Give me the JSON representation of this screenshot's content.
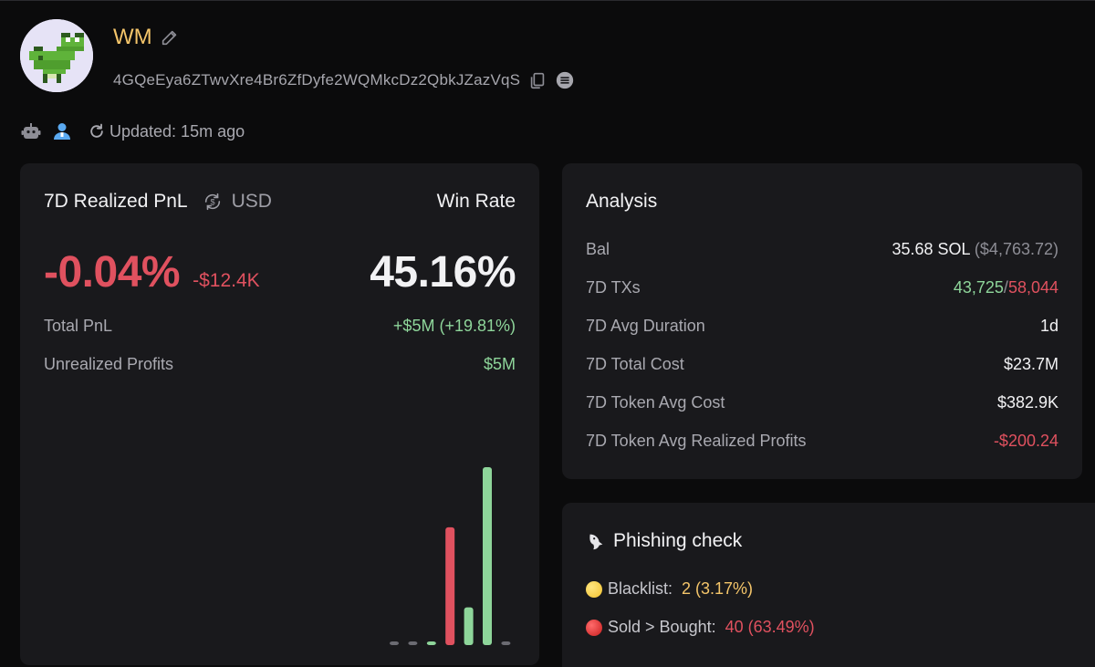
{
  "profile": {
    "name": "WM",
    "address": "4GQeEya6ZTwvXre4Br6ZfDyfe2WQMkcDz2QbkJZazVqS",
    "updated": "Updated: 15m ago"
  },
  "icons": {
    "edit": "pencil-icon",
    "copy": "copy-icon",
    "menu": "menu-icon",
    "bot": "robot-icon",
    "user": "user-icon",
    "refresh": "refresh-icon",
    "swap": "currency-swap-icon",
    "fish": "fish-icon"
  },
  "pnl": {
    "title": "7D Realized PnL",
    "currency": "USD",
    "percent": "-0.04%",
    "usd": "-$12.4K",
    "win_rate_label": "Win Rate",
    "win_rate": "45.16%",
    "total_pnl_label": "Total PnL",
    "total_pnl": "+$5M (+19.81%)",
    "unrealized_label": "Unrealized Profits",
    "unrealized": "$5M"
  },
  "chart_data": {
    "type": "bar",
    "title": "",
    "xlabel": "",
    "ylabel": "",
    "categories": [
      "1",
      "2",
      "3",
      "4",
      "5",
      "6",
      "7"
    ],
    "values": [
      0,
      0,
      1,
      53,
      17,
      80,
      0
    ],
    "bar_colors": [
      "#6b6b72",
      "#6b6b72",
      "#8ed59a",
      "#e0515f",
      "#8ed59a",
      "#8ed59a",
      "#6b6b72"
    ],
    "ylim": [
      0,
      80
    ]
  },
  "analysis": {
    "title": "Analysis",
    "bal_label": "Bal",
    "bal_sol": "35.68 SOL",
    "bal_usd": "($4,763.72)",
    "txs_label": "7D TXs",
    "txs_buy": "43,725",
    "txs_sep": "/",
    "txs_sell": "58,044",
    "duration_label": "7D Avg Duration",
    "duration": "1d",
    "total_cost_label": "7D Total Cost",
    "total_cost": "$23.7M",
    "token_avg_cost_label": "7D Token Avg Cost",
    "token_avg_cost": "$382.9K",
    "token_avg_profit_label": "7D Token Avg Realized Profits",
    "token_avg_profit": "-$200.24"
  },
  "phishing": {
    "title": "Phishing check",
    "blacklist_label": "Blacklist:",
    "blacklist_value": "2 (3.17%)",
    "sold_label": "Sold > Bought:",
    "sold_value": "40 (63.49%)"
  },
  "colors": {
    "positive": "#8ed59a",
    "negative": "#e0515f",
    "accent": "#f4c56a",
    "card": "#19191c",
    "background": "#0b0b0c"
  }
}
